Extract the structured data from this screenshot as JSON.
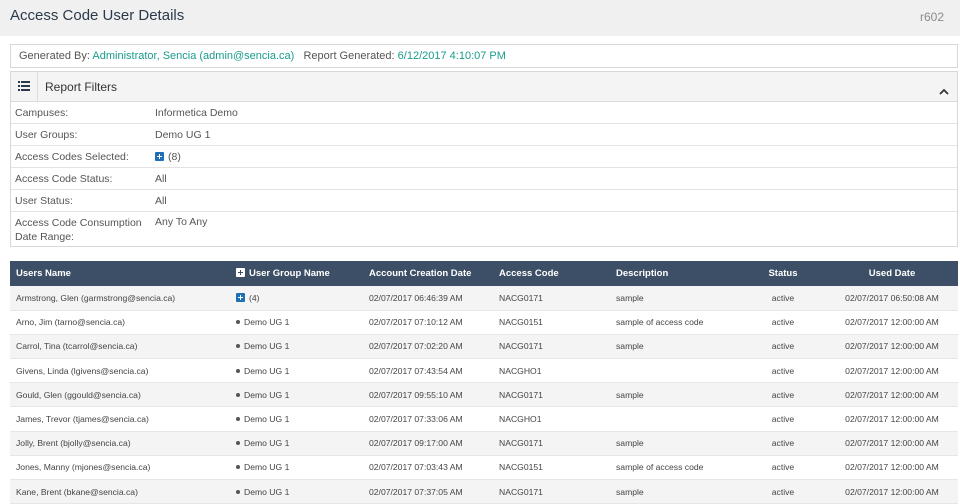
{
  "header": {
    "title": "Access Code User Details",
    "report_code": "r602"
  },
  "generated": {
    "by_label": "Generated By:",
    "by_value": "Administrator, Sencia (admin@sencia.ca)",
    "date_label": "Report Generated:",
    "date_value": "6/12/2017 4:10:07 PM"
  },
  "filters": {
    "title": "Report Filters",
    "rows": [
      {
        "label": "Campuses:",
        "value": "Informetica Demo"
      },
      {
        "label": "User Groups:",
        "value": "Demo UG 1"
      },
      {
        "label": "Access Codes Selected:",
        "value": "(8)"
      },
      {
        "label": "Access Code Status:",
        "value": "All"
      },
      {
        "label": "User Status:",
        "value": "All"
      },
      {
        "label": "Access Code Consumption Date Range:",
        "value": "Any To Any"
      }
    ]
  },
  "table": {
    "columns": [
      "Users Name",
      "User Group Name",
      "Account Creation Date",
      "Access Code",
      "Description",
      "Status",
      "Used Date"
    ],
    "rows": [
      {
        "name": "Armstrong, Glen (garmstrong@sencia.ca)",
        "group": "(4)",
        "created": "02/07/2017 06:46:39 AM",
        "code": "NACG0171",
        "desc": "sample",
        "status": "active",
        "used": "02/07/2017 06:50:08 AM"
      },
      {
        "name": "Arno, Jim (tarno@sencia.ca)",
        "group": "Demo UG 1",
        "created": "02/07/2017 07:10:12 AM",
        "code": "NACG0151",
        "desc": "sample of access code",
        "status": "active",
        "used": "02/07/2017 12:00:00 AM"
      },
      {
        "name": "Carrol, Tina (tcarrol@sencia.ca)",
        "group": "Demo UG 1",
        "created": "02/07/2017 07:02:20 AM",
        "code": "NACG0171",
        "desc": "sample",
        "status": "active",
        "used": "02/07/2017 12:00:00 AM"
      },
      {
        "name": "Givens, Linda (lgivens@sencia.ca)",
        "group": "Demo UG 1",
        "created": "02/07/2017 07:43:54 AM",
        "code": "NACGHO1",
        "desc": "",
        "status": "active",
        "used": "02/07/2017 12:00:00 AM"
      },
      {
        "name": "Gould, Glen (ggould@sencia.ca)",
        "group": "Demo UG 1",
        "created": "02/07/2017 09:55:10 AM",
        "code": "NACG0171",
        "desc": "sample",
        "status": "active",
        "used": "02/07/2017 12:00:00 AM"
      },
      {
        "name": "James, Trevor (tjames@sencia.ca)",
        "group": "Demo UG 1",
        "created": "02/07/2017 07:33:06 AM",
        "code": "NACGHO1",
        "desc": "",
        "status": "active",
        "used": "02/07/2017 12:00:00 AM"
      },
      {
        "name": "Jolly, Brent (bjolly@sencia.ca)",
        "group": "Demo UG 1",
        "created": "02/07/2017 09:17:00 AM",
        "code": "NACG0171",
        "desc": "sample",
        "status": "active",
        "used": "02/07/2017 12:00:00 AM"
      },
      {
        "name": "Jones, Manny (mjones@sencia.ca)",
        "group": "Demo UG 1",
        "created": "02/07/2017 07:03:43 AM",
        "code": "NACG0151",
        "desc": "sample of access code",
        "status": "active",
        "used": "02/07/2017 12:00:00 AM"
      },
      {
        "name": "Kane, Brent (bkane@sencia.ca)",
        "group": "Demo UG 1",
        "created": "02/07/2017 07:37:05 AM",
        "code": "NACG0171",
        "desc": "sample",
        "status": "active",
        "used": "02/07/2017 12:00:00 AM"
      }
    ]
  }
}
